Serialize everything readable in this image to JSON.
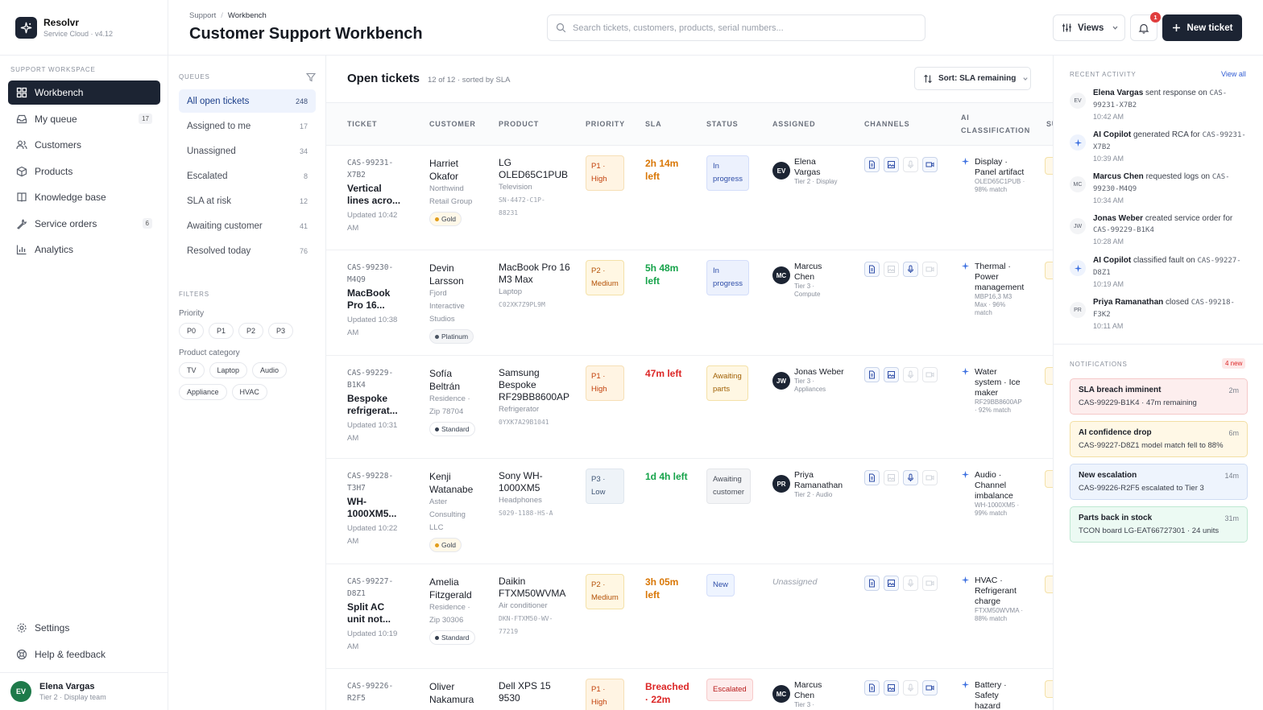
{
  "brand": {
    "name": "Resolvr",
    "version": "Service Cloud · v4.12"
  },
  "sidebar": {
    "section_label": "SUPPORT WORKSPACE",
    "items": [
      {
        "label": "Workbench",
        "count": "",
        "icon": "grid-icon"
      },
      {
        "label": "My queue",
        "count": "17",
        "icon": "inbox-icon"
      },
      {
        "label": "Customers",
        "count": "",
        "icon": "users-icon"
      },
      {
        "label": "Products",
        "count": "",
        "icon": "box-icon"
      },
      {
        "label": "Knowledge base",
        "count": "",
        "icon": "book-icon"
      },
      {
        "label": "Service orders",
        "count": "6",
        "icon": "wrench-icon"
      },
      {
        "label": "Analytics",
        "count": "",
        "icon": "chart-icon"
      }
    ],
    "bottom": [
      {
        "label": "Settings",
        "icon": "gear-icon"
      },
      {
        "label": "Help & feedback",
        "icon": "help-icon"
      }
    ],
    "user": {
      "initials": "EV",
      "name": "Elena Vargas",
      "role": "Tier 2 · Display team"
    }
  },
  "header": {
    "breadcrumb": [
      "Support",
      "Workbench"
    ],
    "title": "Customer Support Workbench",
    "search_placeholder": "Search tickets, customers, products, serial numbers...",
    "views_label": "Views",
    "notif_count": "1",
    "new_ticket_label": "New ticket"
  },
  "queues": {
    "label": "QUEUES",
    "items": [
      {
        "label": "All open tickets",
        "count": "248"
      },
      {
        "label": "Assigned to me",
        "count": "17"
      },
      {
        "label": "Unassigned",
        "count": "34"
      },
      {
        "label": "Escalated",
        "count": "8"
      },
      {
        "label": "SLA at risk",
        "count": "12"
      },
      {
        "label": "Awaiting customer",
        "count": "41"
      },
      {
        "label": "Resolved today",
        "count": "76"
      }
    ],
    "filters_label": "FILTERS",
    "priority_label": "Priority",
    "priorities": [
      "P0",
      "P1",
      "P2",
      "P3"
    ],
    "category_label": "Product category",
    "categories": [
      "TV",
      "Laptop",
      "Audio",
      "Appliance",
      "HVAC"
    ]
  },
  "main": {
    "title": "Open tickets",
    "subtitle": "12 of 12 · sorted by SLA",
    "sort_label": "Sort: SLA remaining",
    "columns": [
      "TICKET",
      "CUSTOMER",
      "PRODUCT",
      "PRIORITY",
      "SLA",
      "STATUS",
      "ASSIGNED",
      "CHANNELS",
      "AI",
      "CLASSIFICATION",
      "SU"
    ]
  },
  "tickets": [
    {
      "id1": "CAS-99231-",
      "id2": "X7B2",
      "title1": "Vertical",
      "title2": "lines acro...",
      "upd1": "Updated 10:42",
      "upd2": "AM",
      "cust1": "Harriet",
      "cust2": "Okafor",
      "org1": "Northwind",
      "org2": "Retail Group",
      "org3": "",
      "tier": "Gold",
      "prod1": "LG",
      "prod2": "OLED65C1PUB",
      "ptype": "Television",
      "sn1": "SN-4472-C1P-",
      "sn2": "88231",
      "prio1": "P1 ·",
      "prio2": "High",
      "sla1": "2h 14m",
      "sla2": "left",
      "st1": "In",
      "st2": "progress",
      "asg_init": "EV",
      "asg1": "Elena",
      "asg2": "Vargas",
      "asg3": "",
      "asg_sub": "Tier 2 · Display",
      "ai1": "Display ·",
      "ai2": "Panel artifact",
      "ai3": "",
      "ai_s1": "OLED65C1PUB ·",
      "ai_s2": "98% match",
      "ai_s3": ""
    },
    {
      "id1": "CAS-99230-",
      "id2": "M4Q9",
      "title1": "MacBook",
      "title2": "Pro 16...",
      "upd1": "Updated 10:38",
      "upd2": "AM",
      "cust1": "Devin",
      "cust2": "Larsson",
      "org1": "Fjord",
      "org2": "Interactive",
      "org3": "Studios",
      "tier": "Platinum",
      "prod1": "MacBook Pro 16",
      "prod2": "M3 Max",
      "ptype": "Laptop",
      "sn1": "C02XK7Z9PL9M",
      "sn2": "",
      "prio1": "P2 ·",
      "prio2": "Medium",
      "sla1": "5h 48m",
      "sla2": "left",
      "st1": "In",
      "st2": "progress",
      "asg_init": "MC",
      "asg1": "Marcus",
      "asg2": "Chen",
      "asg3": "",
      "asg_sub": "Tier 3 ·",
      "asg_sub2": "Compute",
      "ai1": "Thermal ·",
      "ai2": "Power",
      "ai3": "management",
      "ai_s1": "MBP16,3 M3",
      "ai_s2": "Max · 96%",
      "ai_s3": "match"
    },
    {
      "id1": "CAS-99229-",
      "id2": "B1K4",
      "title1": "Bespoke",
      "title2": "refrigerat...",
      "upd1": "Updated 10:31",
      "upd2": "AM",
      "cust1": "Sofía",
      "cust2": "Beltrán",
      "org1": "Residence ·",
      "org2": "Zip 78704",
      "org3": "",
      "tier": "Standard",
      "prod1": "Samsung",
      "prod2": "Bespoke",
      "prod3": "RF29BB8600AP",
      "ptype": "Refrigerator",
      "sn1": "0YXK7A29B1041",
      "sn2": "",
      "prio1": "P1 ·",
      "prio2": "High",
      "sla1": "47m left",
      "sla2": "",
      "st1": "Awaiting",
      "st2": "parts",
      "asg_init": "JW",
      "asg1": "Jonas Weber",
      "asg2": "",
      "asg3": "",
      "asg_sub": "Tier 3 ·",
      "asg_sub2": "Appliances",
      "ai1": "Water",
      "ai2": "system · Ice",
      "ai3": "maker",
      "ai_s1": "RF29BB8600AP",
      "ai_s2": "· 92% match",
      "ai_s3": ""
    },
    {
      "id1": "CAS-99228-",
      "id2": "T3H7",
      "title1": "WH-",
      "title2": "1000XM5...",
      "upd1": "Updated 10:22",
      "upd2": "AM",
      "cust1": "Kenji",
      "cust2": "Watanabe",
      "org1": "Aster",
      "org2": "Consulting",
      "org3": "LLC",
      "tier": "Gold",
      "prod1": "Sony WH-",
      "prod2": "1000XM5",
      "ptype": "Headphones",
      "sn1": "S029-1188-HS-A",
      "sn2": "",
      "prio1": "P3 ·",
      "prio2": "Low",
      "sla1": "1d 4h left",
      "sla2": "",
      "st1": "Awaiting",
      "st2": "customer",
      "asg_init": "PR",
      "asg1": "Priya",
      "asg2": "Ramanathan",
      "asg3": "",
      "asg_sub": "Tier 2 · Audio",
      "ai1": "Audio ·",
      "ai2": "Channel",
      "ai3": "imbalance",
      "ai_s1": "WH-1000XM5 ·",
      "ai_s2": "99% match",
      "ai_s3": ""
    },
    {
      "id1": "CAS-99227-",
      "id2": "D8Z1",
      "title1": "Split AC",
      "title2": "unit not...",
      "upd1": "Updated 10:19",
      "upd2": "AM",
      "cust1": "Amelia",
      "cust2": "Fitzgerald",
      "org1": "Residence ·",
      "org2": "Zip 30306",
      "org3": "",
      "tier": "Standard",
      "prod1": "Daikin",
      "prod2": "FTXM50WVMA",
      "ptype": "Air conditioner",
      "sn1": "DKN-FTXM50-WV-",
      "sn2": "77219",
      "prio1": "P2 ·",
      "prio2": "Medium",
      "sla1": "3h 05m",
      "sla2": "left",
      "st1": "New",
      "st2": "",
      "asg_unassigned": "Unassigned",
      "ai1": "HVAC ·",
      "ai2": "Refrigerant",
      "ai3": "charge",
      "ai_s1": "FTXM50WVMA ·",
      "ai_s2": "88% match",
      "ai_s3": ""
    },
    {
      "id1": "CAS-99226-",
      "id2": "R2F5",
      "cust1": "Oliver",
      "cust2": "Nakamura",
      "prod1": "Dell XPS 15",
      "prod2": "9530",
      "prio1": "P1 ·",
      "prio2": "High",
      "sla1": "Breached",
      "sla2": "· 22m",
      "st1": "Escalated",
      "asg_init": "MC",
      "asg1": "Marcus",
      "asg2": "Chen",
      "asg_sub": "Tier 3 ·",
      "ai1": "Battery ·",
      "ai2": "Safety",
      "ai3": "hazard"
    }
  ],
  "activity": {
    "label": "RECENT ACTIVITY",
    "view_all": "View all",
    "items": [
      {
        "init": "EV",
        "who": "Elena Vargas",
        "what": " sent response on ",
        "ref": "CAS-99231-X7B2",
        "time": "10:42 AM"
      },
      {
        "init": "AI",
        "who": "AI Copilot",
        "what": " generated RCA for ",
        "ref": "CAS-99231-X7B2",
        "time": "10:39 AM"
      },
      {
        "init": "MC",
        "who": "Marcus Chen",
        "what": " requested logs on ",
        "ref": "CAS-99230-M4Q9",
        "time": "10:34 AM"
      },
      {
        "init": "JW",
        "who": "Jonas Weber",
        "what": " created service order for ",
        "ref": "CAS-99229-B1K4",
        "time": "10:28 AM"
      },
      {
        "init": "AI",
        "who": "AI Copilot",
        "what": " classified fault on ",
        "ref": "CAS-99227-D8Z1",
        "time": "10:19 AM"
      },
      {
        "init": "PR",
        "who": "Priya Ramanathan",
        "what": " closed ",
        "ref": "CAS-99218-F3K2",
        "time": "10:11 AM"
      }
    ]
  },
  "notifications": {
    "label": "NOTIFICATIONS",
    "badge": "4 new",
    "items": [
      {
        "title": "SLA breach imminent",
        "msg": "CAS-99229-B1K4 · 47m remaining",
        "ago": "2m",
        "bg": "#fdeeee",
        "border": "#f5c9c9"
      },
      {
        "title": "AI confidence drop",
        "msg": "CAS-99227-D8Z1 model match fell to 88%",
        "ago": "6m",
        "bg": "#fff8e6",
        "border": "#f3dfa4"
      },
      {
        "title": "New escalation",
        "msg": "CAS-99226-R2F5 escalated to Tier 3",
        "ago": "14m",
        "bg": "#eef4fd",
        "border": "#cfdcf3"
      },
      {
        "title": "Parts back in stock",
        "msg": "TCON board LG-EAT66727301 · 24 units",
        "ago": "31m",
        "bg": "#ecfaf3",
        "border": "#bfe8d2"
      }
    ]
  },
  "colors": {
    "accent": "#1c2433",
    "sla_warn": "#d97706",
    "sla_ok": "#16a34a",
    "sla_bad": "#dc2626",
    "gold": "#e29d1a",
    "platinum": "#4b5563"
  }
}
